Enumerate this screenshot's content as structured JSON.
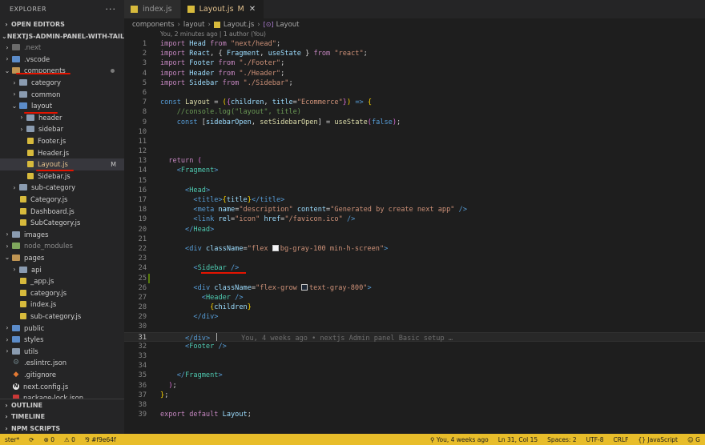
{
  "sidebar": {
    "title": "EXPLORER",
    "more": "···",
    "open_editors": "OPEN EDITORS",
    "project": "NEXTJS-ADMIN-PANEL-WITH-TAILWI...",
    "tree": [
      {
        "label": ".next",
        "depth": 0,
        "chev": "›",
        "icon": "folder-dim",
        "muted": true
      },
      {
        "label": ".vscode",
        "depth": 0,
        "chev": "›",
        "icon": "folder-blue"
      },
      {
        "label": "components",
        "depth": 0,
        "chev": "⌄",
        "icon": "folder-open",
        "dot": true
      },
      {
        "label": "category",
        "depth": 1,
        "chev": "›",
        "icon": "folder"
      },
      {
        "label": "common",
        "depth": 1,
        "chev": "›",
        "icon": "folder"
      },
      {
        "label": "layout",
        "depth": 1,
        "chev": "⌄",
        "icon": "folder-blue"
      },
      {
        "label": "header",
        "depth": 2,
        "chev": "›",
        "icon": "folder"
      },
      {
        "label": "sidebar",
        "depth": 2,
        "chev": "›",
        "icon": "folder"
      },
      {
        "label": "Footer.js",
        "depth": 2,
        "icon": "js"
      },
      {
        "label": "Header.js",
        "depth": 2,
        "icon": "js"
      },
      {
        "label": "Layout.js",
        "depth": 2,
        "icon": "js",
        "active": true,
        "modified": "M"
      },
      {
        "label": "Sidebar.js",
        "depth": 2,
        "icon": "js"
      },
      {
        "label": "sub-category",
        "depth": 1,
        "chev": "›",
        "icon": "folder"
      },
      {
        "label": "Category.js",
        "depth": 1,
        "icon": "js"
      },
      {
        "label": "Dashboard.js",
        "depth": 1,
        "icon": "js"
      },
      {
        "label": "SubCategory.js",
        "depth": 1,
        "icon": "js"
      },
      {
        "label": "images",
        "depth": 0,
        "chev": "›",
        "icon": "folder"
      },
      {
        "label": "node_modules",
        "depth": 0,
        "chev": "›",
        "icon": "folder-green",
        "muted": true
      },
      {
        "label": "pages",
        "depth": 0,
        "chev": "⌄",
        "icon": "folder-open"
      },
      {
        "label": "api",
        "depth": 1,
        "chev": "›",
        "icon": "folder"
      },
      {
        "label": "_app.js",
        "depth": 1,
        "icon": "js"
      },
      {
        "label": "category.js",
        "depth": 1,
        "icon": "js"
      },
      {
        "label": "index.js",
        "depth": 1,
        "icon": "js"
      },
      {
        "label": "sub-category.js",
        "depth": 1,
        "icon": "js"
      },
      {
        "label": "public",
        "depth": 0,
        "chev": "›",
        "icon": "folder-blue"
      },
      {
        "label": "styles",
        "depth": 0,
        "chev": "›",
        "icon": "folder-blue"
      },
      {
        "label": "utils",
        "depth": 0,
        "chev": "›",
        "icon": "folder"
      },
      {
        "label": ".eslintrc.json",
        "depth": 0,
        "icon": "gear"
      },
      {
        "label": ".gitignore",
        "depth": 0,
        "icon": "git"
      },
      {
        "label": "next.config.js",
        "depth": 0,
        "icon": "next"
      },
      {
        "label": "package-lock.json",
        "depth": 0,
        "icon": "npm"
      }
    ],
    "bottom_sections": [
      "OUTLINE",
      "TIMELINE",
      "NPM SCRIPTS"
    ]
  },
  "tabs": [
    {
      "label": "index.js",
      "active": false
    },
    {
      "label": "Layout.js",
      "active": true,
      "modified": "M",
      "close": "✕"
    }
  ],
  "breadcrumb": [
    "components",
    "layout",
    "Layout.js",
    "Layout"
  ],
  "editor": {
    "blame_header": "You, 2 minutes ago | 1 author (You)",
    "inline_blame": "You, 4 weeks ago • nextjs Admin panel Basic setup …",
    "line_numbers": [
      "1",
      "2",
      "3",
      "4",
      "5",
      "6",
      "7",
      "8",
      "9",
      "10",
      "11",
      "12",
      "13",
      "14",
      "15",
      "16",
      "17",
      "18",
      "19",
      "20",
      "21",
      "22",
      "23",
      "24",
      "25",
      "26",
      "27",
      "28",
      "29",
      "30",
      "31",
      "32",
      "33",
      "34",
      "35",
      "36",
      "37",
      "38",
      "39"
    ],
    "current_line": "31",
    "code_strings": {
      "import": "import",
      "from": "from",
      "Head": "Head",
      "React": "React",
      "Fragment": "Fragment",
      "useState": "useState",
      "Footer": "Footer",
      "Header": "Header",
      "Sidebar": "Sidebar",
      "s_head": "\"next/head\"",
      "s_react": "\"react\"",
      "s_footer": "\"./Footer\"",
      "s_header": "\"./Header\"",
      "s_sidebar": "\"./Sidebar\"",
      "const": "const",
      "Layout": "Layout",
      "children": "children",
      "title": "title",
      "s_ecommerce": "\"Ecommerce\"",
      "comment": "//console.log(\"layout\", title)",
      "sidebarOpen": "sidebarOpen",
      "setSidebarOpen": "setSidebarOpen",
      "false": "false",
      "return": "return",
      "meta": "meta",
      "name": "name",
      "content": "content",
      "s_description": "\"description\"",
      "s_generated": "\"Generated by create next app\"",
      "link": "link",
      "rel": "rel",
      "href": "href",
      "s_icon": "\"icon\"",
      "s_favicon": "\"/favicon.ico\"",
      "div": "div",
      "className": "className",
      "s_flex_a": "\"flex ",
      "s_flex_b": "bg-gray-100 min-h-screen\"",
      "s_grow_a": "\"flex-grow ",
      "s_grow_b": "text-gray-800\"",
      "export": "export",
      "default": "default"
    }
  },
  "statusbar": {
    "branch": "ster*",
    "sync_icon": "⟳",
    "errors": "⊗ 0",
    "warnings": "⚠ 0",
    "commit": "⅋ #f9e64f",
    "blame": "⚲ You, 4 weeks ago",
    "position": "Ln 31, Col 15",
    "spaces": "Spaces: 2",
    "encoding": "UTF-8",
    "eol": "CRLF",
    "language": "{} JavaScript",
    "extra": "☺ G"
  }
}
